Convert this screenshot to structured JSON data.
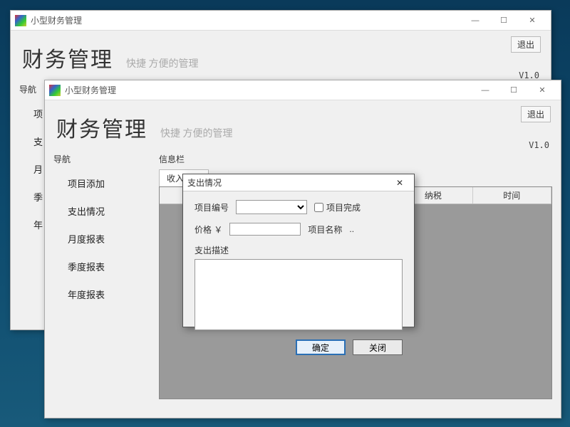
{
  "app": {
    "window_title": "小型财务管理",
    "title": "财务管理",
    "subtitle": "快捷 方便的管理",
    "version": "V1.0",
    "exit_label": "退出"
  },
  "nav": {
    "title": "导航",
    "items": [
      {
        "label": "项目添加"
      },
      {
        "label": "支出情况"
      },
      {
        "label": "月度报表"
      },
      {
        "label": "季度报表"
      },
      {
        "label": "年度报表"
      }
    ],
    "back_items": [
      "项",
      "支",
      "月",
      "季",
      "年"
    ]
  },
  "info": {
    "title": "信息栏",
    "tabs": [
      "收入明细"
    ],
    "columns": [
      "纳税",
      "时间"
    ]
  },
  "dialog": {
    "title": "支出情况",
    "project_no_label": "项目编号",
    "project_done_label": "项目完成",
    "price_label": "价格 ￥",
    "project_name_label": "项目名称",
    "project_name_value": "..",
    "desc_label": "支出描述",
    "ok_label": "确定",
    "close_label": "关闭"
  },
  "win": {
    "min": "—",
    "max": "☐",
    "close": "✕"
  }
}
